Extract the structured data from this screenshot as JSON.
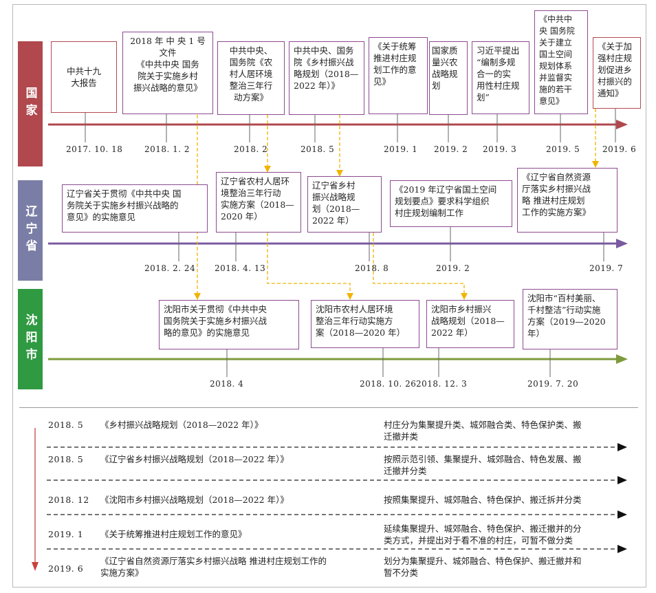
{
  "bands": {
    "national": "国家",
    "province": "辽宁省",
    "city": "沈阳市"
  },
  "national": {
    "events": [
      {
        "text": "中共十九\n大报告",
        "date": "2017. 10. 18"
      },
      {
        "text": "2018 年 中 央 1 号\n文件\n《中共中央  国务\n院关于实施乡村\n振兴战略的意见》",
        "date": "2018. 1. 2"
      },
      {
        "text": "中共中央、\n国务院《农\n村人居环境\n整治三年行\n动方案》",
        "date": "2018. 2"
      },
      {
        "text": "中共中央、国务\n院《乡村振兴战\n略规划（2018—\n2022 年）》",
        "date": "2018. 5"
      },
      {
        "text": "《关于统筹\n推进村庄规\n划工作的意\n见》",
        "date": "2019. 1"
      },
      {
        "text": "国家质\n量兴农\n战略规划",
        "date": "2019. 2"
      },
      {
        "text": "习近平提出\n“编制多规\n合一的实\n用性村庄规\n划”",
        "date": "2019. 3"
      },
      {
        "text": "《中共中\n央 国务院\n关于建立\n国土空间\n规划体系\n并监督实\n施的若干\n意见》",
        "date": "2019. 5"
      },
      {
        "text": "《关于加\n强村庄规\n划促进乡\n村振兴的\n通知》",
        "date": "2019. 6"
      }
    ]
  },
  "province": {
    "events": [
      {
        "text": "辽宁省关于贯彻《中共中央  国\n务院关于实施乡村振兴战略的\n意见》的实施意见",
        "date": "2018. 2. 24"
      },
      {
        "text": "辽宁省农村人居环\n境整治三年行动\n实施方案（2018—\n2020 年）",
        "date": "2018. 4. 13"
      },
      {
        "text": "辽宁省乡村\n振兴战略规\n划（2018—\n2022 年）",
        "date": "2018. 8"
      },
      {
        "text": "《2019 年辽宁省国土空间\n规划要点》要求科学组织\n村庄规划编制工作",
        "date": "2019. 2"
      },
      {
        "text": "《辽宁省自然资源\n厅落实乡村振兴战\n略  推进村庄规划\n工作的实施方案》",
        "date": "2019. 7"
      }
    ]
  },
  "city": {
    "events": [
      {
        "text": "沈阳市关于贯彻《中共中央\n国务院关于实施乡村振兴战\n略的意见》的实施意见",
        "date": "2018. 4"
      },
      {
        "text": "沈阳市农村人居环境\n整治三年行动实施方\n案（2018—2020 年）",
        "date": "2018. 10. 26"
      },
      {
        "text": "沈阳市乡村振兴\n战略规划（2018—\n2022 年）",
        "date": "2018. 12. 3"
      },
      {
        "text": "沈阳市“百村美丽、\n千村整洁”行动实施\n方案（2019—2020 年）",
        "date": "2019. 7. 20"
      }
    ]
  },
  "classification": [
    {
      "date": "2018. 5",
      "title": "《乡村振兴战略规划（2018—2022 年）》",
      "desc": "村庄分为集聚提升类、城郊融合类、特色保护类、搬\n迁撤并类"
    },
    {
      "date": "2018. 5",
      "title": "《辽宁省乡村振兴战略规划（2018—2022 年）》",
      "desc": "按照示范引领、集聚提升、城郊融合、特色发展、搬\n迁撤并分类"
    },
    {
      "date": "2018. 12",
      "title": "《沈阳市乡村振兴战略规划（2018—2022 年）》",
      "desc": "按照集聚提升、城郊融合、特色保护、搬迁拆并分类"
    },
    {
      "date": "2019. 1",
      "title": "《关于统筹推进村庄规划工作的意见》",
      "desc": "延续集聚提升、城郊融合、特色保护、搬迁撤并的分\n类方式，并提出对于看不准的村庄，可暂不做分类"
    },
    {
      "date": "2019. 6",
      "title": "《辽宁省自然资源厅落实乡村振兴战略  推进村庄规划工作的\n实施方案》",
      "desc": "划分为集聚提升、城郊融合、特色保护、搬迁撤并和\n暂不分类"
    }
  ],
  "colors": {
    "national": "#b0484d",
    "province": "#7a7ea6",
    "city": "#2f9a42",
    "connector": "#f0b400",
    "box_border": "#8c4a8f"
  }
}
